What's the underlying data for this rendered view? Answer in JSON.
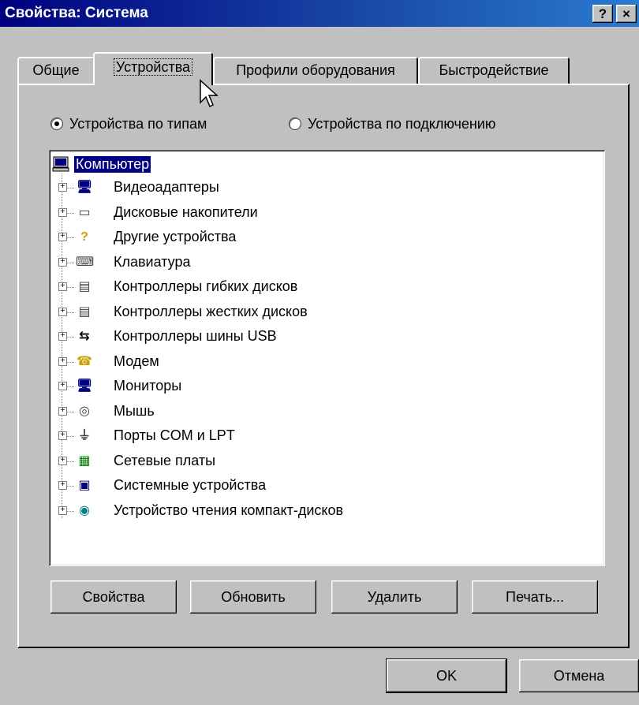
{
  "window": {
    "title": "Свойства: Система",
    "help_button": "?",
    "close_button": "×"
  },
  "tabs": [
    {
      "label": "Общие",
      "active": false
    },
    {
      "label": "Устройства",
      "active": true
    },
    {
      "label": "Профили оборудования",
      "active": false
    },
    {
      "label": "Быстродействие",
      "active": false
    }
  ],
  "view_mode": {
    "by_type": {
      "label": "Устройства по типам",
      "selected": true
    },
    "by_connection": {
      "label": "Устройства по подключению",
      "selected": false
    }
  },
  "tree": {
    "root": {
      "label": "Компьютер",
      "icon": "computer-icon"
    },
    "items": [
      {
        "label": "Видеоадаптеры",
        "icon": "display-adapter-icon"
      },
      {
        "label": "Дисковые накопители",
        "icon": "disk-drive-icon"
      },
      {
        "label": "Другие устройства",
        "icon": "question-icon"
      },
      {
        "label": "Клавиатура",
        "icon": "keyboard-icon"
      },
      {
        "label": "Контроллеры гибких дисков",
        "icon": "floppy-controller-icon"
      },
      {
        "label": "Контроллеры жестких дисков",
        "icon": "hdd-controller-icon"
      },
      {
        "label": "Контроллеры шины USB",
        "icon": "usb-icon"
      },
      {
        "label": "Модем",
        "icon": "modem-icon"
      },
      {
        "label": "Мониторы",
        "icon": "monitor-icon"
      },
      {
        "label": "Мышь",
        "icon": "mouse-icon"
      },
      {
        "label": "Порты COM и LPT",
        "icon": "port-icon"
      },
      {
        "label": "Сетевые платы",
        "icon": "network-card-icon"
      },
      {
        "label": "Системные устройства",
        "icon": "system-device-icon"
      },
      {
        "label": "Устройство чтения компакт-дисков",
        "icon": "cdrom-icon"
      }
    ]
  },
  "buttons": {
    "properties": "Свойства",
    "refresh": "Обновить",
    "remove": "Удалить",
    "print": "Печать...",
    "ok": "OK",
    "cancel": "Отмена"
  },
  "colors": {
    "titlebar": "#000080",
    "face": "#c0c0c0",
    "selection": "#000080"
  }
}
